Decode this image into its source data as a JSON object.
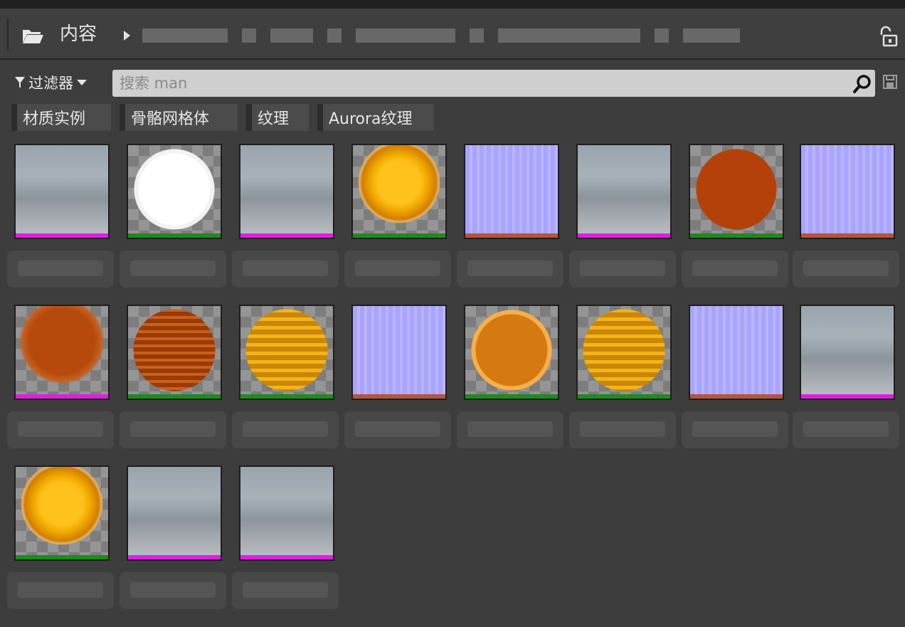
{
  "path": {
    "root_label": "内容"
  },
  "toolbar": {
    "filter_label": "过滤器",
    "search_placeholder": "搜索 man"
  },
  "chips": [
    {
      "label": "材质实例"
    },
    {
      "label": "骨骼网格体"
    },
    {
      "label": "纹理"
    },
    {
      "label": "Aurora纹理"
    }
  ],
  "colors": {
    "material_instance": "#e01ee0",
    "material": "#1e8a1e",
    "texture": "#b5553a",
    "panel_bg": "#3d3d3d"
  },
  "assets": [
    {
      "row": 0,
      "col": 0,
      "thumb": "floor-scene",
      "type_color": "#e01ee0"
    },
    {
      "row": 0,
      "col": 1,
      "thumb": "white-sphere",
      "type_color": "#1e8a1e"
    },
    {
      "row": 0,
      "col": 2,
      "thumb": "floor-scene",
      "type_color": "#e01ee0"
    },
    {
      "row": 0,
      "col": 3,
      "thumb": "gold-sphere",
      "type_color": "#1e8a1e"
    },
    {
      "row": 0,
      "col": 4,
      "thumb": "normal-map",
      "type_color": "#b5553a"
    },
    {
      "row": 0,
      "col": 5,
      "thumb": "floor-scene",
      "type_color": "#e01ee0"
    },
    {
      "row": 0,
      "col": 6,
      "thumb": "rust-sphere",
      "type_color": "#1e8a1e"
    },
    {
      "row": 0,
      "col": 7,
      "thumb": "normal-map",
      "type_color": "#b5553a"
    },
    {
      "row": 1,
      "col": 0,
      "thumb": "rust-blob",
      "type_color": "#e01ee0"
    },
    {
      "row": 1,
      "col": 1,
      "thumb": "carved-sphere-dark",
      "type_color": "#1e8a1e"
    },
    {
      "row": 1,
      "col": 2,
      "thumb": "carved-sphere-gold",
      "type_color": "#1e8a1e"
    },
    {
      "row": 1,
      "col": 3,
      "thumb": "normal-map",
      "type_color": "#b5553a"
    },
    {
      "row": 1,
      "col": 4,
      "thumb": "orange-sphere",
      "type_color": "#1e8a1e"
    },
    {
      "row": 1,
      "col": 5,
      "thumb": "carved-sphere-gold",
      "type_color": "#1e8a1e"
    },
    {
      "row": 1,
      "col": 6,
      "thumb": "normal-map",
      "type_color": "#b5553a"
    },
    {
      "row": 1,
      "col": 7,
      "thumb": "floor-scene",
      "type_color": "#e01ee0"
    },
    {
      "row": 2,
      "col": 0,
      "thumb": "gold-sphere",
      "type_color": "#1e8a1e"
    },
    {
      "row": 2,
      "col": 1,
      "thumb": "floor-scene",
      "type_color": "#e01ee0"
    },
    {
      "row": 2,
      "col": 2,
      "thumb": "floor-scene",
      "type_color": "#e01ee0"
    }
  ]
}
